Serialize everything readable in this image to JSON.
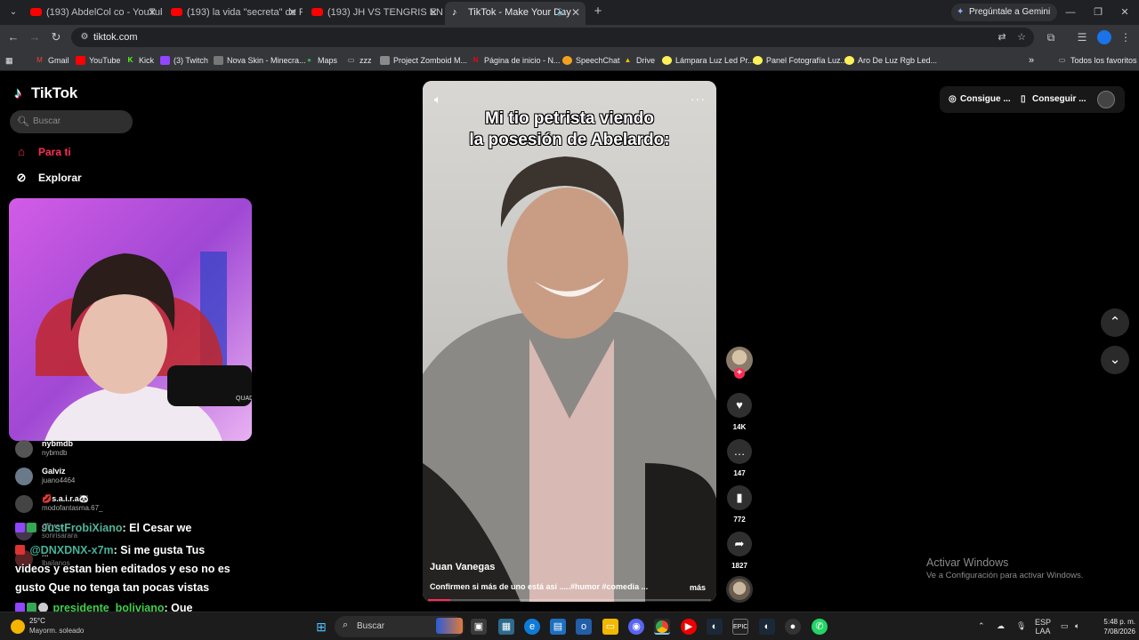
{
  "browser": {
    "tabs": [
      {
        "title": "(193) AbdelCol co - YouTube",
        "active": false
      },
      {
        "title": "(193) la vida \"secreta\" de RoRo",
        "active": false
      },
      {
        "title": "(193) JH VS TENGRIS EN LA VE",
        "active": false
      },
      {
        "title": "TikTok - Make Your Day",
        "active": true
      }
    ],
    "gemini_label": "Pregúntale a Gemini",
    "url": "tiktok.com",
    "bookmarks": [
      {
        "label": "Gmail",
        "icon": "gmail-icon",
        "color": "#ea4335"
      },
      {
        "label": "YouTube",
        "icon": "youtube-icon",
        "color": "#ff0000"
      },
      {
        "label": "Kick",
        "icon": "kick-icon",
        "color": "#53fc18"
      },
      {
        "label": "(3) Twitch",
        "icon": "twitch-icon",
        "color": "#9146ff"
      },
      {
        "label": "Nova Skin - Minecra...",
        "icon": "nova-skin-icon",
        "color": "#888888"
      },
      {
        "label": "Maps",
        "icon": "maps-icon",
        "color": "#34a853"
      },
      {
        "label": "zzz",
        "icon": "folder-icon",
        "color": "#c8c8c8"
      },
      {
        "label": "Project Zomboid M...",
        "icon": "steam-icon",
        "color": "#aaaaaa"
      },
      {
        "label": "Página de inicio - N...",
        "icon": "netflix-icon",
        "color": "#e50914"
      },
      {
        "label": "SpeechChat",
        "icon": "speechchat-icon",
        "color": "#f4a020"
      },
      {
        "label": "Drive",
        "icon": "drive-icon",
        "color": "#fbbc04"
      },
      {
        "label": "Lámpara Luz Led Pr...",
        "icon": "mercadolibre-icon",
        "color": "#fff159"
      },
      {
        "label": "Panel Fotografía Luz...",
        "icon": "mercadolibre-icon",
        "color": "#fff159"
      },
      {
        "label": "Aro De Luz Rgb Led...",
        "icon": "mercadolibre-icon",
        "color": "#fff159"
      }
    ],
    "all_bookmarks": "Todos los favoritos"
  },
  "tiktok": {
    "logo": "TikTok",
    "search_placeholder": "Buscar",
    "nav": [
      {
        "label": "Para ti",
        "icon": "home-icon",
        "active": true
      },
      {
        "label": "Explorar",
        "icon": "compass-icon",
        "active": false
      }
    ],
    "accounts": [
      {
        "name": "nybmdb",
        "handle": "nybmdb"
      },
      {
        "name": "Galviz",
        "handle": "juano4464"
      },
      {
        "name": "💋s.a.i.r.a🐼",
        "handle": "modofantasma.67_"
      },
      {
        "name": "oliver",
        "handle": "sonrisarara"
      },
      {
        "name": "...",
        "handle": "lbailanos"
      }
    ],
    "video": {
      "caption_line1": "Mi tio petrista viendo",
      "caption_line2": "la posesión de Abelardo:",
      "author": "Juan Vanegas",
      "description": "Confirmen si más de uno está así .....#humor #comedia ...",
      "more": "más",
      "progress": 0.08
    },
    "actions": {
      "likes": "14K",
      "comments": "147",
      "saves": "772",
      "shares": "1827"
    },
    "top_right": {
      "coins": "Consigue ...",
      "app": "Conseguir ..."
    }
  },
  "chat": [
    {
      "user": "JustFrobiXiano",
      "text": ": El Cesar we"
    },
    {
      "user": "@DNXDNX-x7m",
      "text": ": Si me gusta Tus"
    },
    {
      "user": "",
      "text": "videos y estan bien editados y eso no es"
    },
    {
      "user": "",
      "text": "gusto Que no tenga tan pocas vistas"
    },
    {
      "user": "presidente_boliviano",
      "text": ": Que"
    }
  ],
  "windows": {
    "activate_title": "Activar Windows",
    "activate_sub": "Ve a Configuración para activar Windows.",
    "weather_temp": "25°C",
    "weather_desc": "Mayorm. soleado",
    "search": "Buscar",
    "lang1": "ESP",
    "lang2": "LAA",
    "time": "5:48 p. m.",
    "date": "7/08/2026"
  }
}
